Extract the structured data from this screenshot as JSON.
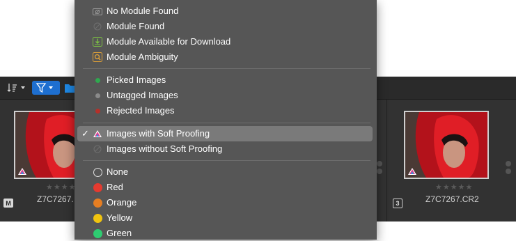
{
  "toolbar": {
    "sort_icon": "sort-icon",
    "filter_icon": "filter-icon",
    "folder_icon": "folder-icon"
  },
  "thumbnails": [
    {
      "filename": "Z7C7267.",
      "stars": "★★★★★",
      "badge": "M"
    },
    {
      "filename": "Z7C7267.CR2",
      "stars": "★★★★★",
      "badge": "3"
    }
  ],
  "menu": {
    "module_items": [
      {
        "label": "No Module Found",
        "icon": "no-module-icon"
      },
      {
        "label": "Module Found",
        "icon": "module-found-icon"
      },
      {
        "label": "Module Available for Download",
        "icon": "download-icon",
        "color": "#7cc043"
      },
      {
        "label": "Module Ambiguity",
        "icon": "ambiguity-icon",
        "color": "#e2a236"
      }
    ],
    "flag_items": [
      {
        "label": "Picked Images",
        "color": "#2fa84f"
      },
      {
        "label": "Untagged Images",
        "color": "#8a8a8a"
      },
      {
        "label": "Rejected Images",
        "color": "#c0392b"
      }
    ],
    "proof_items": [
      {
        "label": "Images with Soft Proofing",
        "selected": true
      },
      {
        "label": "Images without Soft Proofing",
        "selected": false
      }
    ],
    "color_items": [
      {
        "label": "None",
        "color": "none"
      },
      {
        "label": "Red",
        "color": "#e74c3c"
      },
      {
        "label": "Orange",
        "color": "#e67e22"
      },
      {
        "label": "Yellow",
        "color": "#f1c40f"
      },
      {
        "label": "Green",
        "color": "#2ecc71"
      }
    ],
    "check_mark": "✓"
  }
}
